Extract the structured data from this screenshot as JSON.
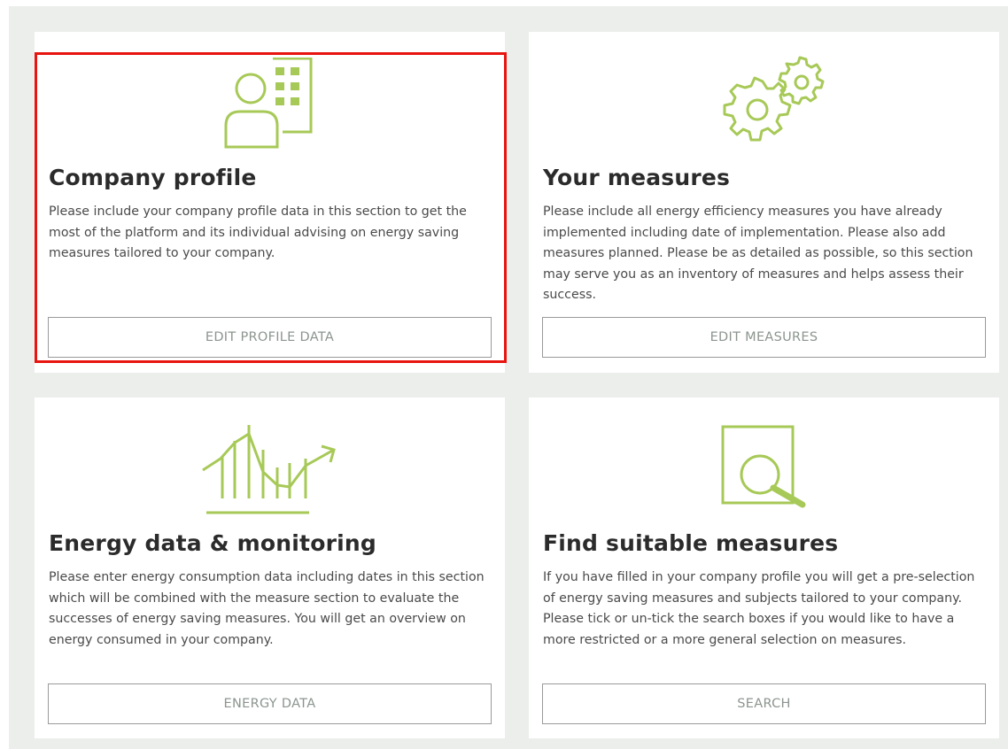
{
  "cards": [
    {
      "title": "Company profile",
      "description": "Please include your company profile data in this section to get the most of the platform and its individual advising on energy saving measures tailored to your company.",
      "button": "EDIT PROFILE DATA",
      "icon": "company-profile-icon"
    },
    {
      "title": "Your measures",
      "description": "Please include all energy efficiency measures you have already implemented including date of implementation. Please also add measures planned. Please be as detailed as possible, so this section may serve you as an inventory of measures and helps assess their success.",
      "button": "EDIT MEASURES",
      "icon": "gears-icon"
    },
    {
      "title": "Energy data & monitoring",
      "description": "Please enter energy consumption data including dates in this section which will be combined with the measure section to evaluate the successes of energy saving measures. You will get an overview on energy consumed in your company.",
      "button": "ENERGY DATA",
      "icon": "chart-trend-icon"
    },
    {
      "title": "Find suitable measures",
      "description": "If you have filled in your company profile you will get a pre-selection of energy saving measures and subjects tailored to your company. Please tick or un-tick the search boxes if you would like to have a more restricted or a more general selection on measures.",
      "button": "SEARCH",
      "icon": "document-search-icon"
    }
  ],
  "colors": {
    "accent": "#a7c957",
    "highlight": "#e8140f",
    "background": "#eceeec"
  }
}
